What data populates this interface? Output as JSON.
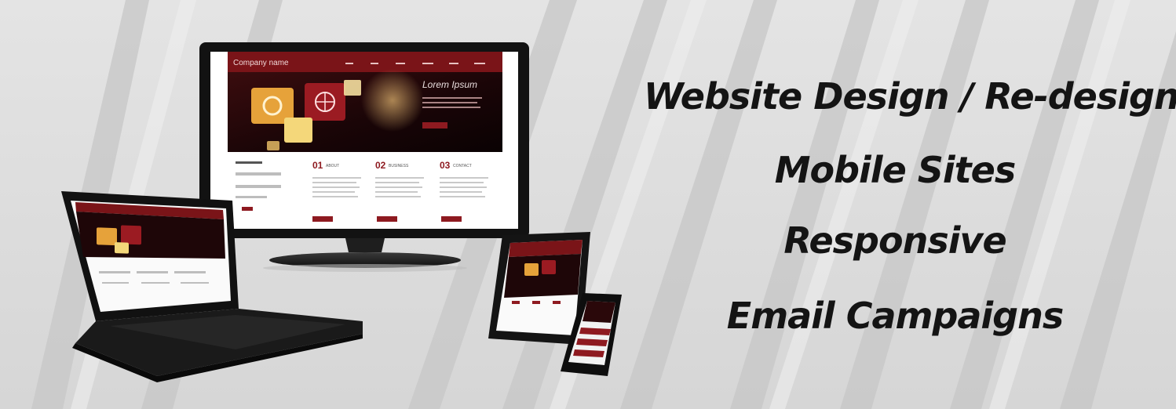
{
  "banner": {
    "services": [
      "Website Design / Re-design",
      "Mobile Sites",
      "Responsive",
      "Email Campaigns"
    ]
  },
  "monitor_site": {
    "company": "Company name",
    "hero_title": "Lorem Ipsum",
    "sections": [
      {
        "num": "01",
        "label": "ABOUT"
      },
      {
        "num": "02",
        "label": "BUSINESS"
      },
      {
        "num": "03",
        "label": "CONTACT"
      }
    ]
  },
  "colors": {
    "accent": "#7a1418",
    "text": "#141414",
    "background": "#dcdcdc"
  }
}
